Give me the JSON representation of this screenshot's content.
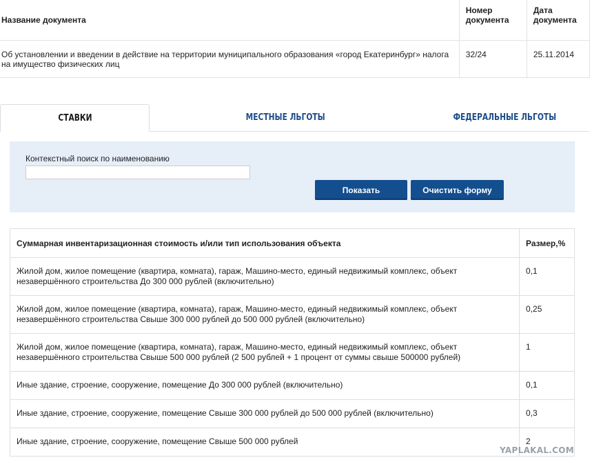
{
  "document_table": {
    "headers": {
      "name": "Название документа",
      "number": "Номер документа",
      "date": "Дата документа"
    },
    "row": {
      "name": "Об установлении и введении в действие на территории муниципального образования «город Екатеринбург» налога на имущество физических лиц",
      "number": "32/24",
      "date": "25.11.2014"
    }
  },
  "tabs": [
    {
      "label": "СТАВКИ",
      "active": true
    },
    {
      "label": "МЕСТНЫЕ ЛЬГОТЫ",
      "active": false
    },
    {
      "label": "ФЕДЕРАЛЬНЫЕ ЛЬГОТЫ",
      "active": false
    }
  ],
  "search": {
    "label": "Контекстный поиск по наименованию",
    "value": "",
    "placeholder": "",
    "show_button": "Показать",
    "clear_button": "Очистить форму"
  },
  "rates_table": {
    "headers": {
      "object": "Суммарная инвентаризационная стоимость и/или тип использования объекта",
      "size": "Размер,%"
    },
    "rows": [
      {
        "object": "Жилой дом, жилое помещение (квартира, комната), гараж, Машино-место, единый недвижимый комплекс, объект незавершённого строительства До 300 000 рублей (включительно)",
        "size": "0,1"
      },
      {
        "object": "Жилой дом, жилое помещение (квартира, комната), гараж, Машино-место, единый недвижимый комплекс, объект незавершённого строительства Свыше 300 000 рублей до 500 000 рублей (включительно)",
        "size": "0,25"
      },
      {
        "object": "Жилой дом, жилое помещение (квартира, комната), гараж, Машино-место, единый недвижимый комплекс, объект незавершённого строительства Свыше 500 000 рублей (2 500 рублей + 1 процент от суммы свыше 500000 рублей)",
        "size": "1"
      },
      {
        "object": "Иные здание, строение, сооружение, помещение До 300 000 рублей (включительно)",
        "size": "0,1"
      },
      {
        "object": "Иные здание, строение, сооружение, помещение Свыше 300 000 рублей до 500 000 рублей (включительно)",
        "size": "0,3"
      },
      {
        "object": "Иные здание, строение, сооружение, помещение Свыше 500 000 рублей",
        "size": "2"
      }
    ]
  },
  "watermark": "YAPLAKAL.COM",
  "colors": {
    "accent_blue": "#134e8e",
    "tab_link": "#1d4d8a",
    "panel_bg": "#e6eef8"
  }
}
